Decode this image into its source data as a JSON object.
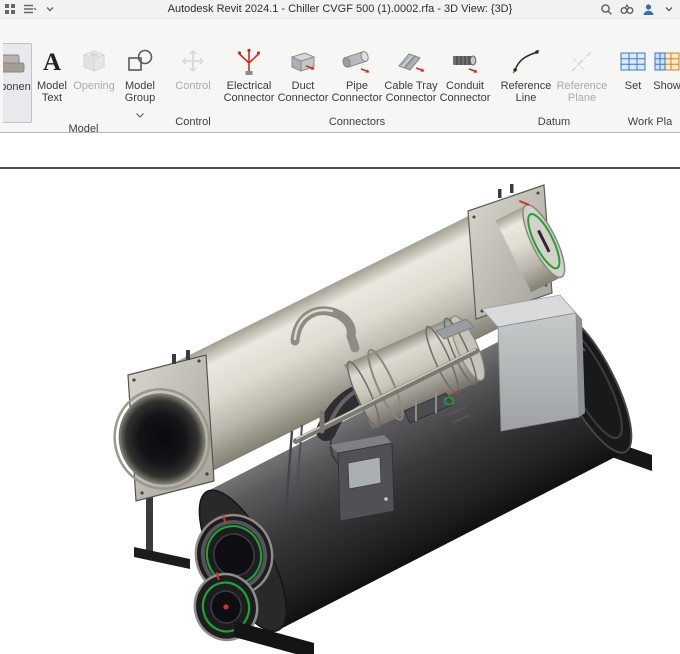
{
  "titlebar": {
    "title": "Autodesk Revit 2024.1 - Chiller CVGF 500 (1).0002.rfa - 3D View: {3D}"
  },
  "ribbon": {
    "groups": [
      {
        "label": "Model",
        "buttons": [
          {
            "id": "component",
            "line1": "ponent",
            "line2": ""
          },
          {
            "id": "model-text",
            "line1": "Model",
            "line2": "Text"
          },
          {
            "id": "opening",
            "line1": "Opening",
            "line2": "",
            "disabled": true
          },
          {
            "id": "model-group",
            "line1": "Model",
            "line2": "Group"
          }
        ]
      },
      {
        "label": "Control",
        "buttons": [
          {
            "id": "control",
            "line1": "Control",
            "line2": "",
            "disabled": true
          }
        ]
      },
      {
        "label": "Connectors",
        "buttons": [
          {
            "id": "electrical-connector",
            "line1": "Electrical",
            "line2": "Connector"
          },
          {
            "id": "duct-connector",
            "line1": "Duct",
            "line2": "Connector"
          },
          {
            "id": "pipe-connector",
            "line1": "Pipe",
            "line2": "Connector"
          },
          {
            "id": "cable-tray-connector",
            "line1": "Cable Tray",
            "line2": "Connector"
          },
          {
            "id": "conduit-connector",
            "line1": "Conduit",
            "line2": "Connector"
          }
        ]
      },
      {
        "label": "Datum",
        "buttons": [
          {
            "id": "reference-line",
            "line1": "Reference",
            "line2": "Line"
          },
          {
            "id": "reference-plane",
            "line1": "Reference",
            "line2": "Plane",
            "disabled": true
          }
        ]
      },
      {
        "label": "Work Pla",
        "buttons": [
          {
            "id": "set",
            "line1": "Set",
            "line2": ""
          },
          {
            "id": "show",
            "line1": "Show",
            "line2": ""
          }
        ]
      }
    ]
  },
  "icons": {
    "model_text_glyph": "A",
    "titlebar_left": [
      "app-grid-icon",
      "menu-icon",
      "chevron-down-icon"
    ],
    "titlebar_right": [
      "search-icon",
      "binoculars-icon",
      "user-icon",
      "chevron-down-icon"
    ]
  },
  "colors": {
    "connector_green": "#21a038",
    "connector_red": "#d03030",
    "view_border": "#4f4f50",
    "ribbon_bg": "#f6f6f5"
  }
}
